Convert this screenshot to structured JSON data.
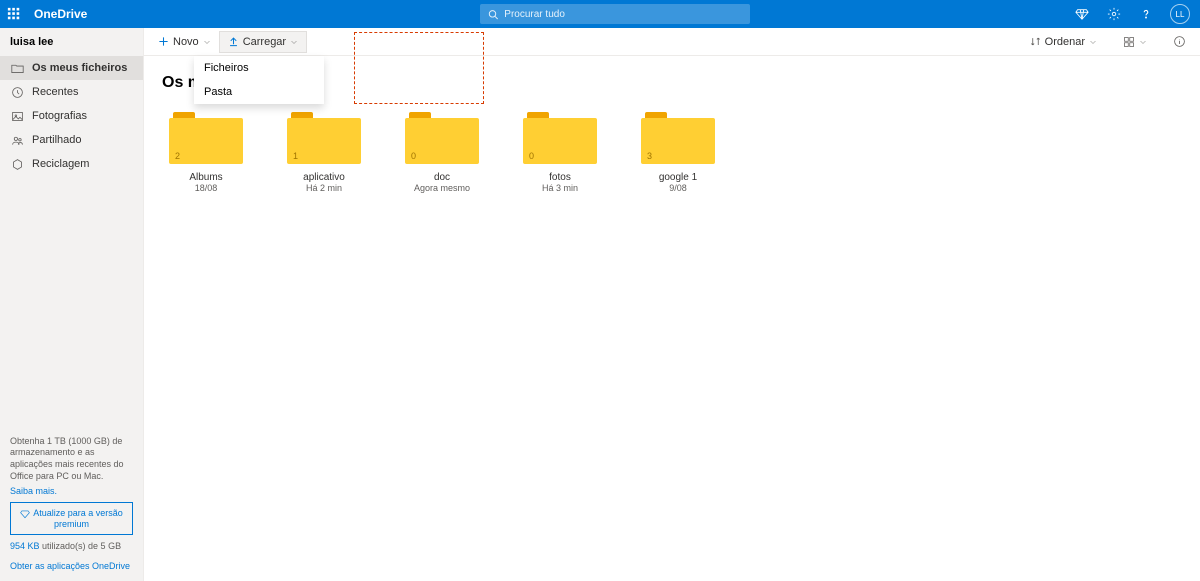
{
  "header": {
    "brand": "OneDrive",
    "search_placeholder": "Procurar tudo",
    "avatar_initials": "LL"
  },
  "sidebar": {
    "user": "luisa lee",
    "items": [
      {
        "label": "Os meus ficheiros"
      },
      {
        "label": "Recentes"
      },
      {
        "label": "Fotografias"
      },
      {
        "label": "Partilhado"
      },
      {
        "label": "Reciclagem"
      }
    ],
    "pitch": "Obtenha 1 TB (1000 GB) de armazenamento e as aplicações mais recentes do Office para PC ou Mac.",
    "learn_more": "Saiba mais.",
    "upgrade_line1": "Atualize para a versão",
    "upgrade_line2": "premium",
    "storage_used": "954 KB",
    "storage_rest": " utilizado(s) de 5 GB",
    "get_apps": "Obter as aplicações OneDrive"
  },
  "toolbar": {
    "new_label": "Novo",
    "upload_label": "Carregar",
    "sort_label": "Ordenar"
  },
  "dropdown": {
    "files": "Ficheiros",
    "folder": "Pasta"
  },
  "page_title": "Os meus ficheiros",
  "files": [
    {
      "name": "Albums",
      "date": "18/08",
      "count": "2"
    },
    {
      "name": "aplicativo",
      "date": "Há 2 min",
      "count": "1"
    },
    {
      "name": "doc",
      "date": "Agora mesmo",
      "count": "0"
    },
    {
      "name": "fotos",
      "date": "Há 3 min",
      "count": "0"
    },
    {
      "name": "google 1",
      "date": "9/08",
      "count": "3"
    }
  ]
}
